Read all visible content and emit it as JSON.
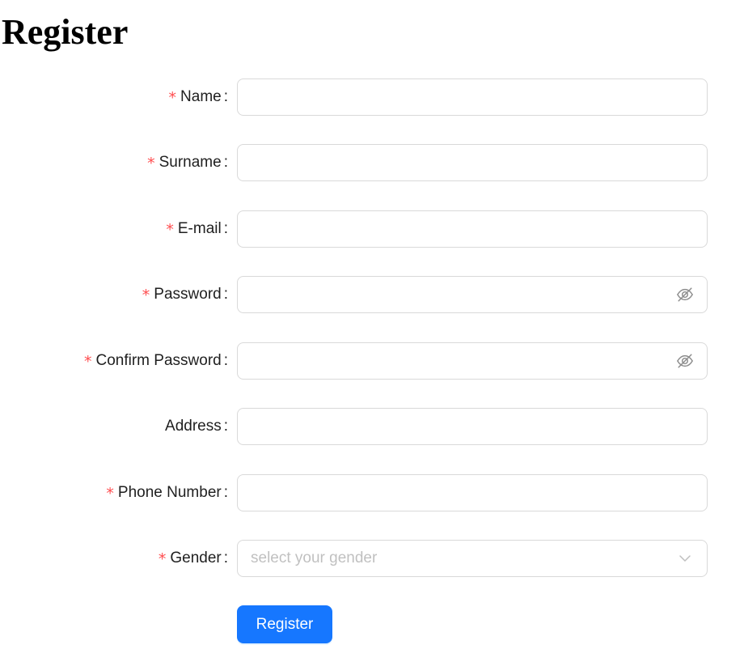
{
  "page": {
    "title": "Register"
  },
  "form": {
    "label_separator": ":",
    "required_mark": "*",
    "fields": {
      "name": {
        "label": "Name",
        "value": "",
        "required": true
      },
      "surname": {
        "label": "Surname",
        "value": "",
        "required": true
      },
      "email": {
        "label": "E-mail",
        "value": "",
        "required": true
      },
      "password": {
        "label": "Password",
        "value": "",
        "required": true,
        "suffix_icon": "eye-invisible-icon"
      },
      "confirm_password": {
        "label": "Confirm Password",
        "value": "",
        "required": true,
        "suffix_icon": "eye-invisible-icon"
      },
      "address": {
        "label": "Address",
        "value": "",
        "required": false
      },
      "phone": {
        "label": "Phone Number",
        "value": "",
        "required": true
      },
      "gender": {
        "label": "Gender",
        "placeholder": "select your gender",
        "required": true,
        "suffix_icon": "chevron-down-icon"
      }
    },
    "submit_label": "Register"
  },
  "colors": {
    "primary": "#1677ff",
    "required": "#ff4d4f",
    "border": "#d9d9d9",
    "placeholder": "#bfbfbf"
  }
}
